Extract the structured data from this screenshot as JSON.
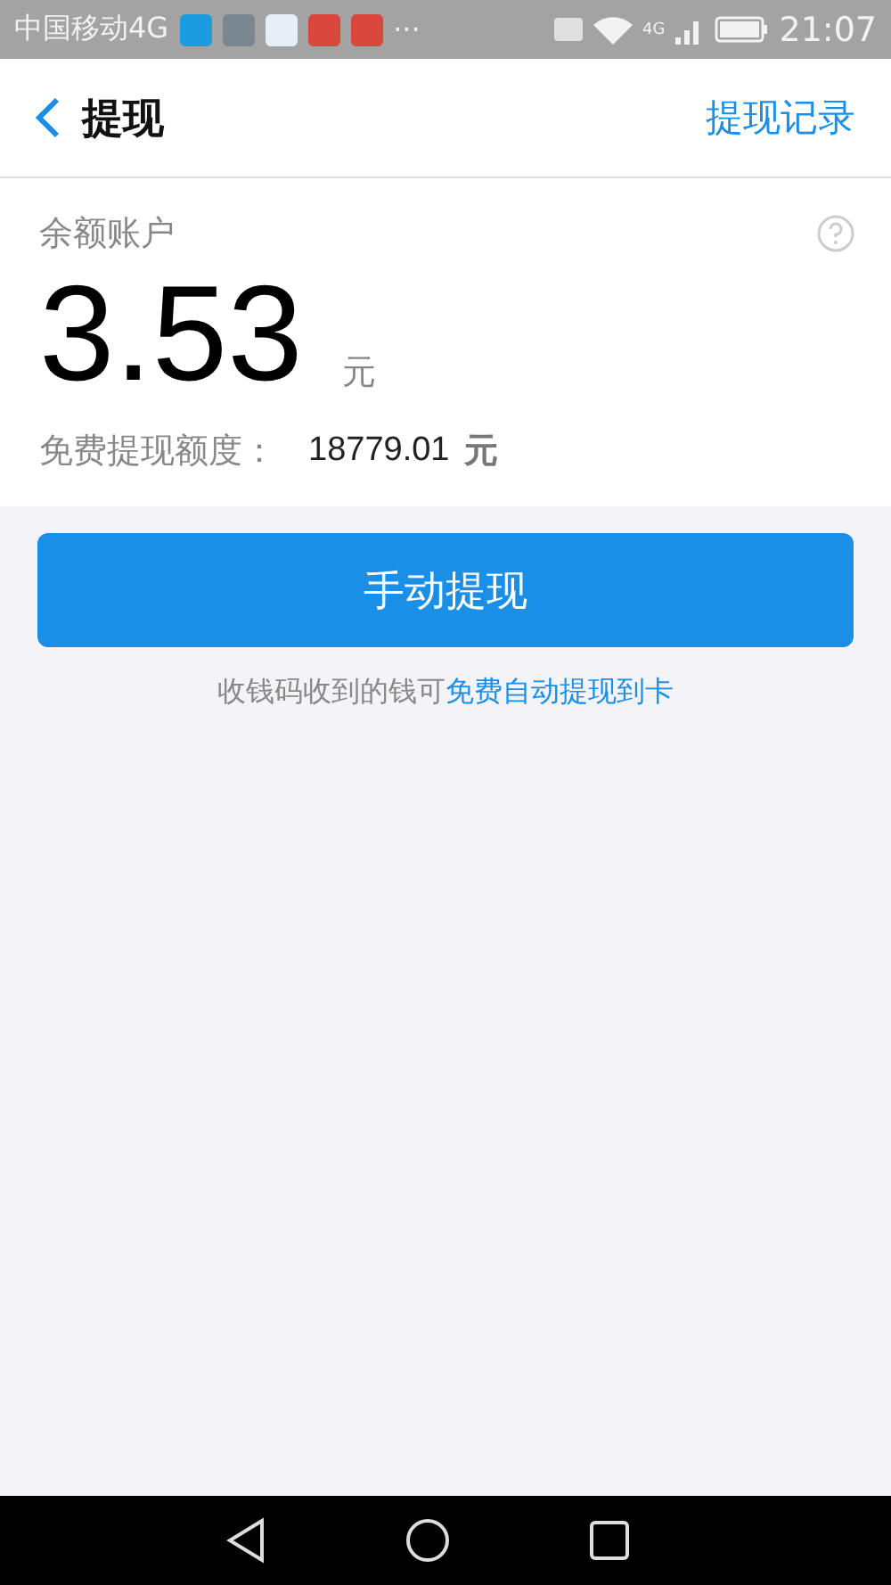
{
  "status_bar": {
    "carrier": "中国移动4G",
    "more": "···",
    "network": "4G",
    "time": "21:07"
  },
  "header": {
    "title": "提现",
    "action": "提现记录"
  },
  "balance": {
    "label": "余额账户",
    "amount": "3.53",
    "unit": "元",
    "quota_label": "免费提现额度：",
    "quota_value": "18779.01",
    "quota_unit": "元"
  },
  "primary_button": "手动提现",
  "note": {
    "text": "收钱码收到的钱可",
    "link": "免费自动提现到卡"
  }
}
